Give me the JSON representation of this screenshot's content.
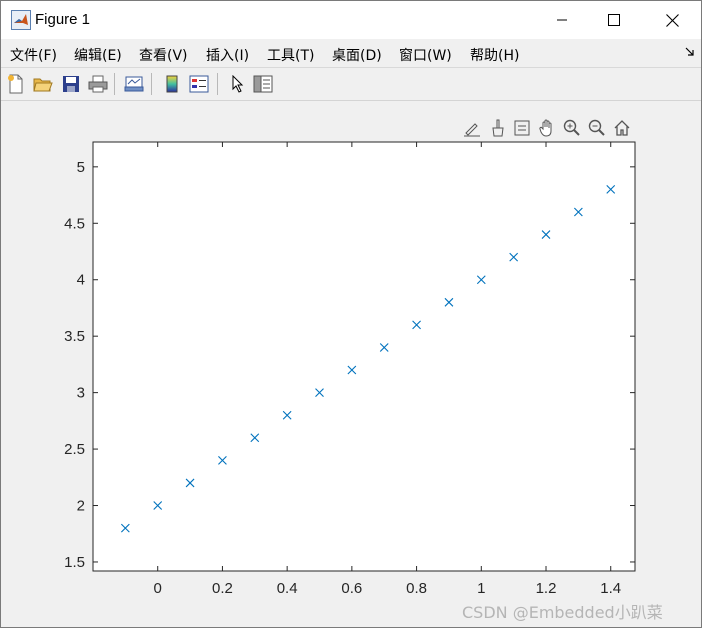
{
  "window": {
    "title": "Figure 1",
    "controls": [
      "minimize-icon",
      "maximize-icon",
      "close-icon"
    ]
  },
  "menu": {
    "items": [
      {
        "label": "文件(F)"
      },
      {
        "label": "编辑(E)"
      },
      {
        "label": "查看(V)"
      },
      {
        "label": "插入(I)"
      },
      {
        "label": "工具(T)"
      },
      {
        "label": "桌面(D)"
      },
      {
        "label": "窗口(W)"
      },
      {
        "label": "帮助(H)"
      }
    ],
    "overflow_icon": "overflow-arrow-icon"
  },
  "toolbar": {
    "icons": [
      "new-figure-icon",
      "open-file-icon",
      "save-icon",
      "print-icon",
      "link-plot-icon",
      "colorbar-icon",
      "legend-icon",
      "pointer-icon",
      "property-inspector-icon"
    ]
  },
  "axes_toolbar": {
    "icons": [
      "brush-edit-icon",
      "data-brush-icon",
      "data-tips-icon",
      "pan-hand-icon",
      "zoom-in-icon",
      "zoom-out-icon",
      "home-icon"
    ]
  },
  "chart_data": {
    "type": "scatter",
    "marker": "x",
    "color": "#0072BD",
    "x": [
      -0.1,
      0,
      0.1,
      0.2,
      0.3,
      0.4,
      0.5,
      0.6,
      0.7,
      0.8,
      0.9,
      1.0,
      1.1,
      1.2,
      1.3,
      1.4
    ],
    "y": [
      1.8,
      2.0,
      2.2,
      2.4,
      2.6,
      2.8,
      3.0,
      3.2,
      3.4,
      3.6,
      3.8,
      4.0,
      4.2,
      4.4,
      4.6,
      4.8
    ],
    "xlim": [
      -0.2,
      1.475
    ],
    "ylim": [
      1.42,
      5.22
    ],
    "xticks": [
      0,
      0.2,
      0.4,
      0.6,
      0.8,
      1.0,
      1.2,
      1.4
    ],
    "xtick_labels": [
      "0",
      "0.2",
      "0.4",
      "0.6",
      "0.8",
      "1",
      "1.2",
      "1.4"
    ],
    "yticks": [
      1.5,
      2,
      2.5,
      3,
      3.5,
      4,
      4.5,
      5
    ],
    "ytick_labels": [
      "1.5",
      "2",
      "2.5",
      "3",
      "3.5",
      "4",
      "4.5",
      "5"
    ],
    "title": "",
    "xlabel": "",
    "ylabel": "",
    "grid": false
  },
  "watermark": "CSDN @Embedded小趴菜"
}
